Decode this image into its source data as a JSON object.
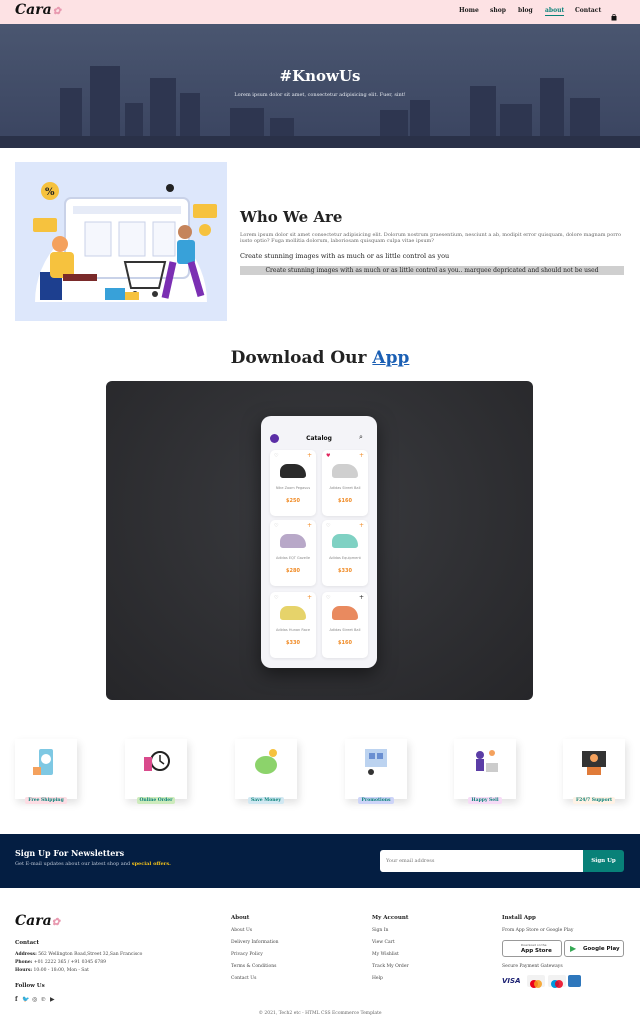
{
  "header": {
    "logo": "Cara",
    "nav": [
      "Home",
      "shop",
      "blog",
      "about",
      "Contact"
    ],
    "active": "about",
    "cart_icon": "shopping-bag-icon"
  },
  "hero": {
    "title": "#KnowUs",
    "subtitle": "Lorem ipsum dolor sit amet, consectetur adipisicing elit. Fuer, sint!"
  },
  "about": {
    "heading": "Who We Are",
    "paragraph": "Lorem ipsum dolor sit amet consectetur adipisicing elit. Dolorum nostrum praesentium, nesciunt a ab, modipit error quisquam, dolore magnam porro iusto optio? Fuga mollitia dolorum, laboriosam quisquam culpa vitae ipsum?",
    "bold_line": "Create stunning images with as much or as little control as you",
    "marquee": "Create stunning images with as much or as little control as you.. marquee depricated and should not be used"
  },
  "download": {
    "heading_prefix": "Download Our",
    "heading_link": "App",
    "app": {
      "title": "Catalog",
      "products": [
        {
          "name": "Nike Zoom Pegasus",
          "price": "$250",
          "liked": false
        },
        {
          "name": "Adidas Street Ball",
          "price": "$160",
          "liked": true
        },
        {
          "name": "Adidas EQT Gazelle",
          "price": "$280",
          "liked": false
        },
        {
          "name": "Adidas Equipment",
          "price": "$330",
          "liked": false
        },
        {
          "name": "Adidas Hunan Race",
          "price": "$330",
          "liked": false
        },
        {
          "name": "Adidas Street Ball",
          "price": "$160",
          "liked": false
        }
      ]
    }
  },
  "features": [
    {
      "label": "Free Shipping",
      "color": "#fddde4"
    },
    {
      "label": "Online Order",
      "color": "#cdebbc"
    },
    {
      "label": "Save Money",
      "color": "#d1e8f2"
    },
    {
      "label": "Promotions",
      "color": "#cdd4f8"
    },
    {
      "label": "Happy Sell",
      "color": "#f6dbf6"
    },
    {
      "label": "F24/7 Support",
      "color": "#fff2e5"
    }
  ],
  "newsletter": {
    "heading": "Sign Up For Newsletters",
    "text_prefix": "Get E-mail updates about our latest shop and",
    "text_highlight": "special offers.",
    "placeholder": "Your email address",
    "button": "Sign Up"
  },
  "footer": {
    "logo": "Cara",
    "contact_heading": "Contact",
    "address_label": "Address:",
    "address": "562 Wellington Road,Street 32,San Francisco",
    "phone_label": "Phone:",
    "phone": "+01 2222 365 / +91 0345 6789",
    "hours_label": "Hours:",
    "hours": "10:00 - 18:00, Mon - Sat",
    "follow_heading": "Follow Us",
    "social_icons": [
      "facebook-icon",
      "twitter-icon",
      "instagram-icon",
      "pinterest-icon",
      "youtube-icon"
    ],
    "about_heading": "About",
    "about_links": [
      "About Us",
      "Delivery Information",
      "Privacy Policy",
      "Terms & Conditions",
      "Contact Us"
    ],
    "account_heading": "My Account",
    "account_links": [
      "Sign In",
      "View Cart",
      "My Wishlist",
      "Track My Order",
      "Help"
    ],
    "install_heading": "Install App",
    "install_text": "From App Store or Google Play",
    "appstore_small": "Download on the",
    "appstore_big": "App Store",
    "gplay_big": "Google Play",
    "payment_heading": "Secure Payment Gateways",
    "payments": [
      "VISA",
      "mastercard",
      "Maestro",
      "AMEX"
    ],
    "copyright": "© 2021, Tech2 etc - HTML CSS Ecommerce Template"
  },
  "colors": {
    "accent": "#088178",
    "header_bg": "#fde2e4",
    "newsletter_bg": "#041e42",
    "link_blue": "#1a5fb4"
  }
}
